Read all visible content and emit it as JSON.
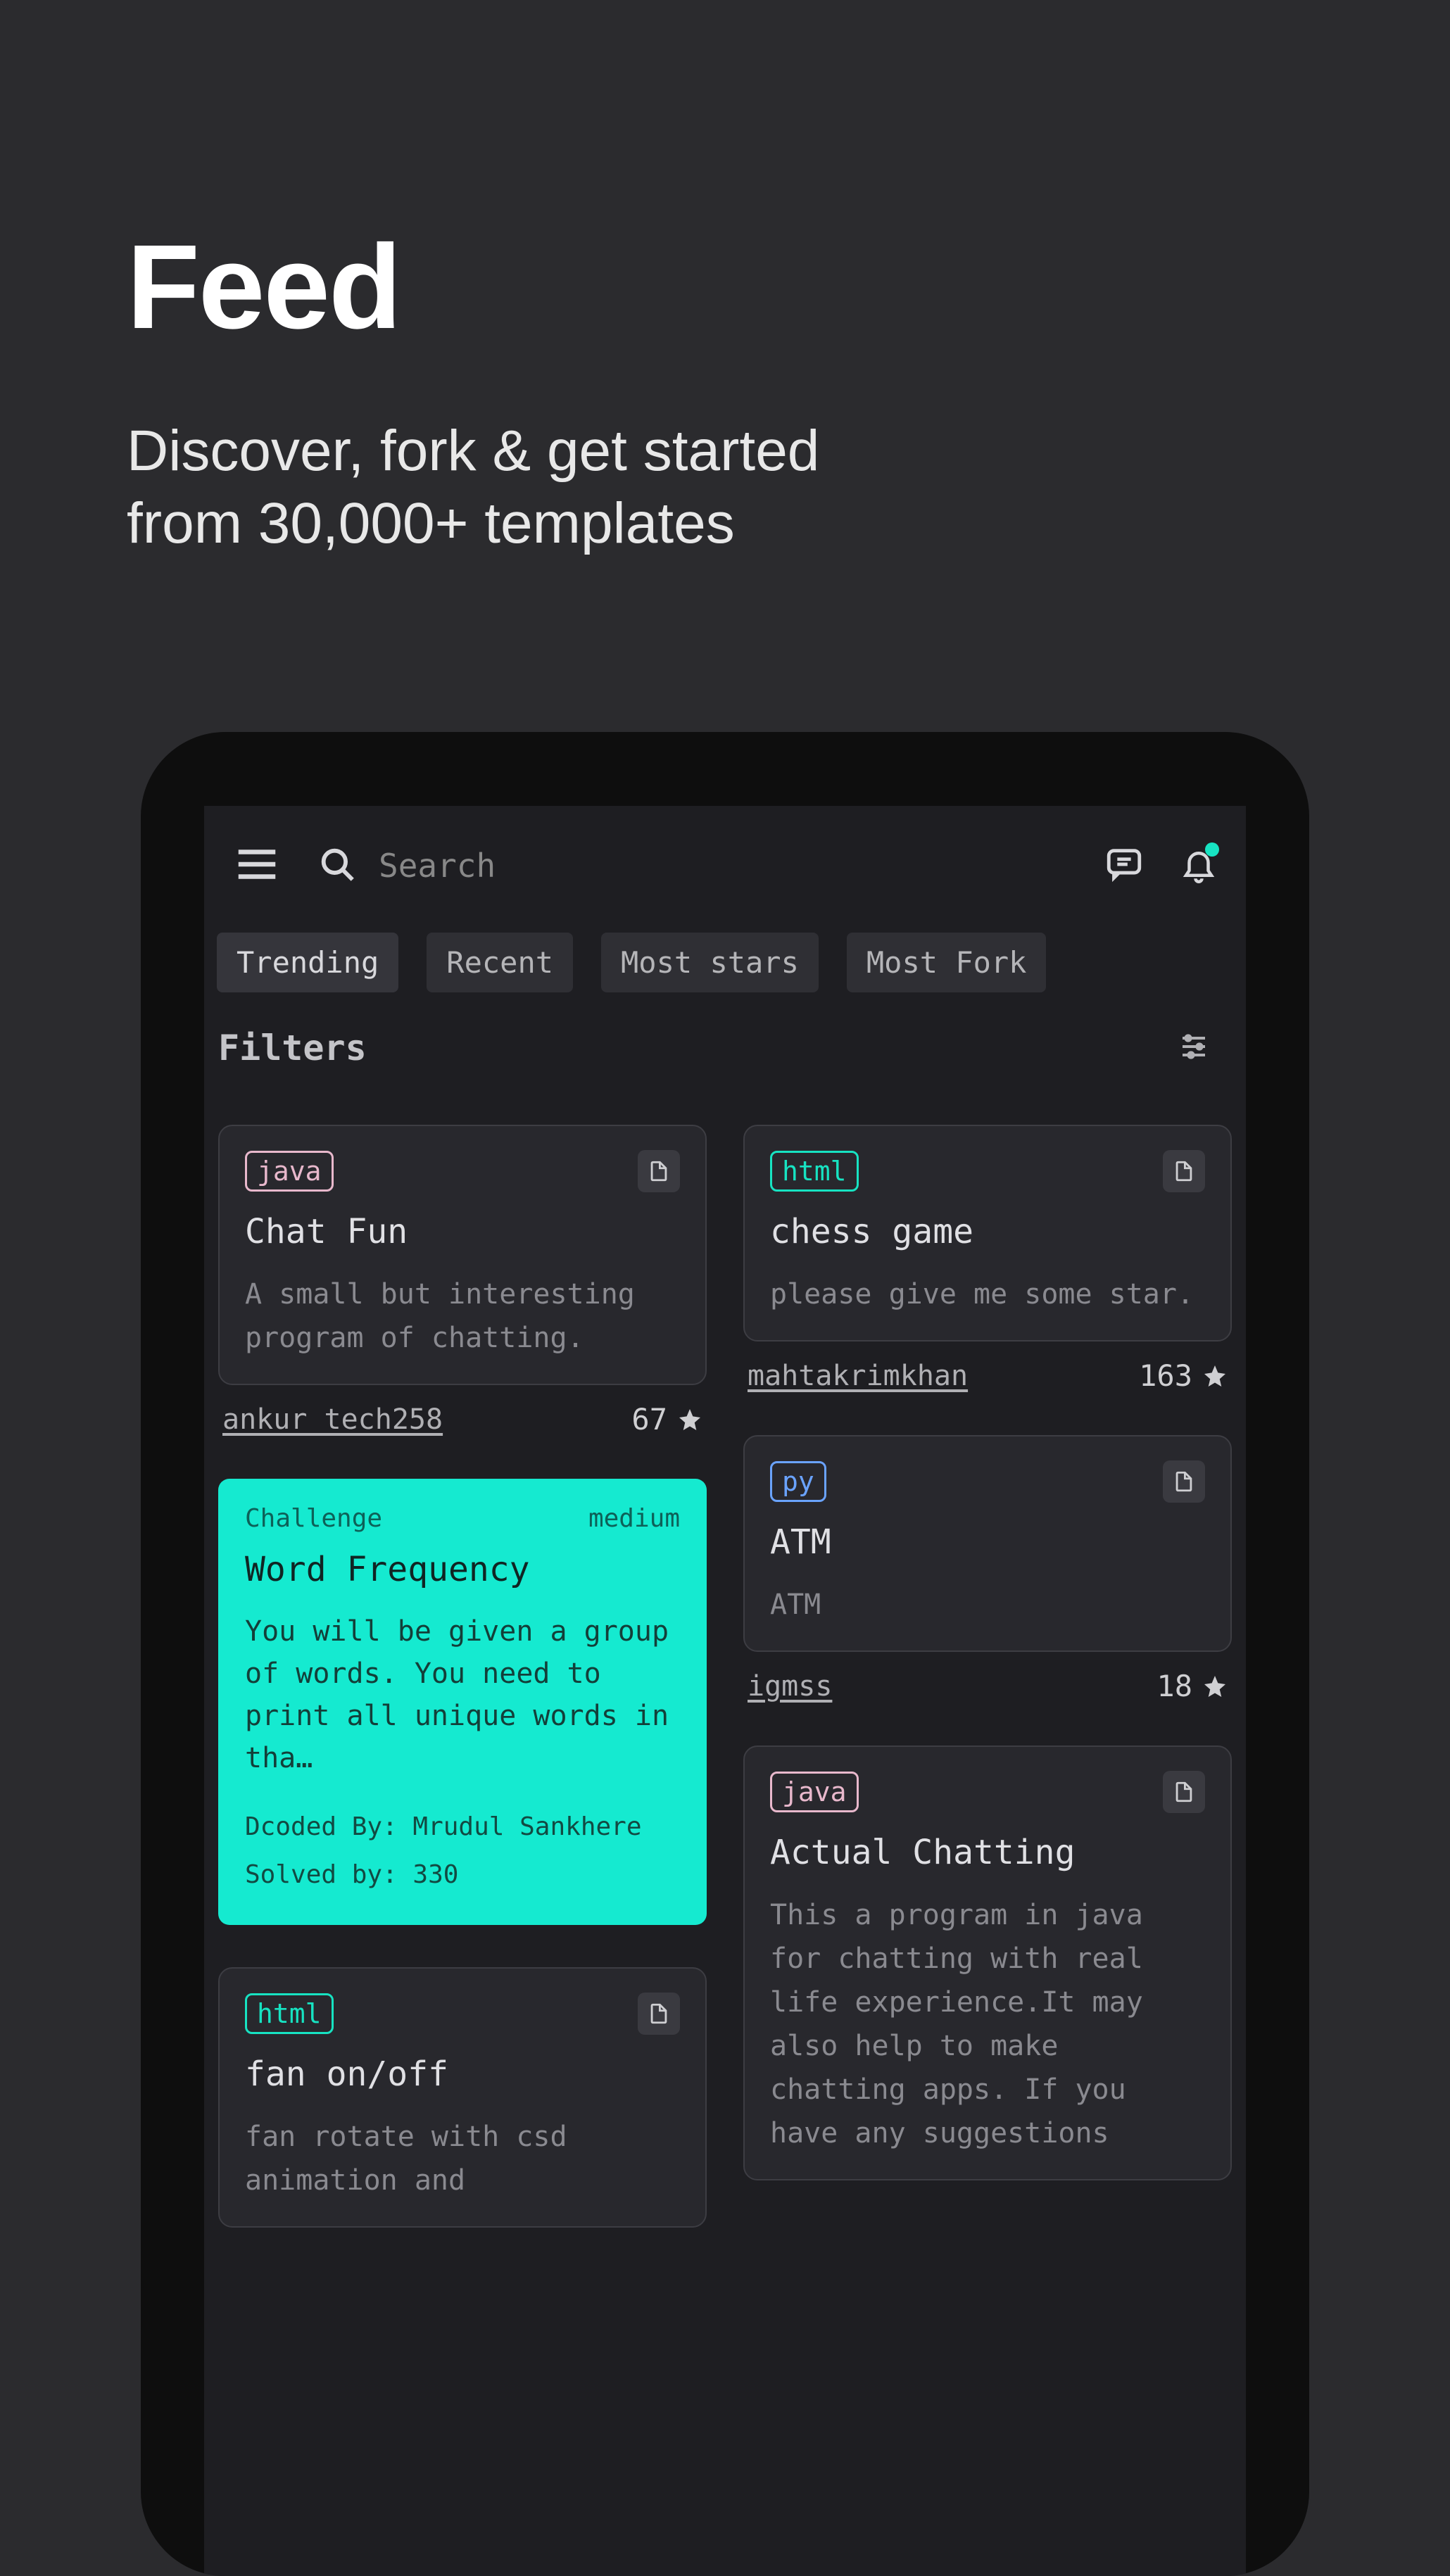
{
  "hero": {
    "title": "Feed",
    "subtitle_line1": "Discover, fork & get started",
    "subtitle_line2": "from 30,000+ templates"
  },
  "search": {
    "placeholder": "Search"
  },
  "tabs": [
    "Trending",
    "Recent",
    "Most stars",
    "Most Fork"
  ],
  "filters_label": "Filters",
  "left": [
    {
      "lang": "java",
      "lang_class": "lang-java",
      "title": "Chat Fun",
      "desc": "A small but interesting program of chatting.",
      "author": "ankur_tech258",
      "stars": "67"
    },
    {
      "type": "challenge",
      "badge": "Challenge",
      "difficulty": "medium",
      "title": "Word Frequency",
      "desc": "You will be given a group of words. You need to print all unique words in tha…",
      "dcoded_by": "Dcoded By:   Mrudul Sankhere",
      "solved_by": "Solved by:   330"
    },
    {
      "lang": "html",
      "lang_class": "lang-html",
      "title": "fan on/off",
      "desc": "fan rotate with csd animation and"
    }
  ],
  "right": [
    {
      "lang": "html",
      "lang_class": "lang-html",
      "title": "chess game",
      "desc": "please give me some star.",
      "author": "mahtakrimkhan",
      "stars": "163"
    },
    {
      "lang": "py",
      "lang_class": "lang-py",
      "title": "ATM",
      "desc": "ATM",
      "author": "igmss",
      "stars": "18"
    },
    {
      "lang": "java",
      "lang_class": "lang-java",
      "title": "Actual Chatting",
      "desc": "This a program in java for chatting with real life experience.It may also help to make chatting apps. If you have any suggestions"
    }
  ]
}
